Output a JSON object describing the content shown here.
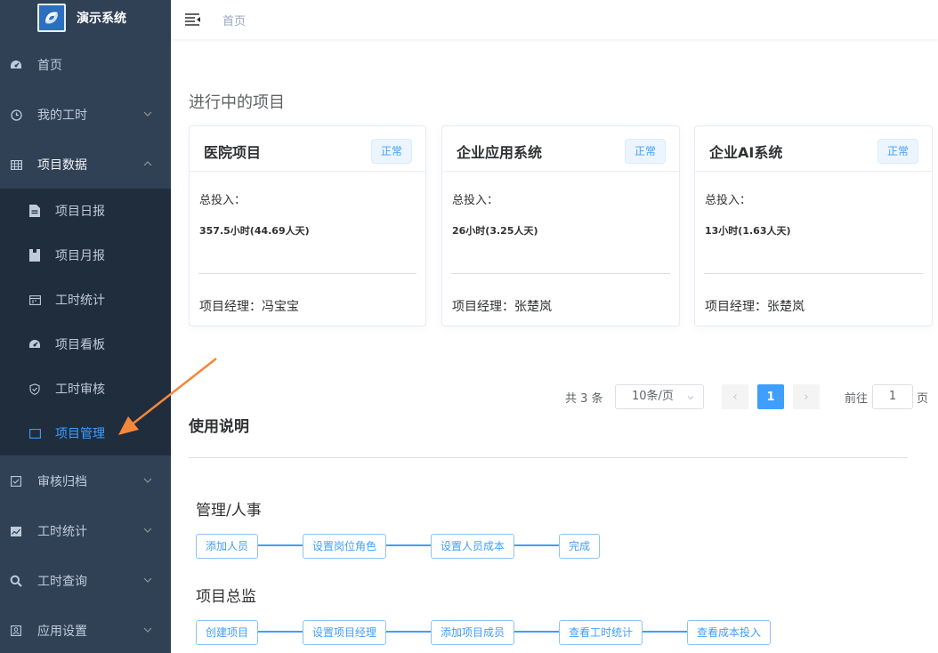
{
  "app": {
    "title": "演示系统",
    "colors": {
      "sidebar": "#304156",
      "submenu": "#1f2d3d",
      "accent": "#409eff",
      "annotation": "#f5873b"
    }
  },
  "sidebar": {
    "items": [
      {
        "label": "首页",
        "icon": "dashboard-icon"
      },
      {
        "label": "我的工时",
        "icon": "clock-icon",
        "arrow": "chevron-down"
      },
      {
        "label": "项目数据",
        "icon": "table-icon",
        "arrow": "chevron-up",
        "expanded": true
      },
      {
        "label": "审核归档",
        "icon": "checkbox-icon",
        "arrow": "chevron-down"
      },
      {
        "label": "工时统计",
        "icon": "image-chart-icon",
        "arrow": "chevron-down"
      },
      {
        "label": "工时查询",
        "icon": "search-icon",
        "arrow": "chevron-down"
      },
      {
        "label": "应用设置",
        "icon": "settings-icon",
        "arrow": "chevron-down"
      }
    ],
    "subitems": [
      {
        "label": "项目日报",
        "icon": "document-icon"
      },
      {
        "label": "项目月报",
        "icon": "clipboard-icon"
      },
      {
        "label": "工时统计",
        "icon": "calendar-icon"
      },
      {
        "label": "项目看板",
        "icon": "dashboard-icon"
      },
      {
        "label": "工时审核",
        "icon": "shield-icon"
      },
      {
        "label": "项目管理",
        "icon": "monitor-icon",
        "active": true
      }
    ]
  },
  "header": {
    "breadcrumb": "首页"
  },
  "projects": {
    "section_title": "进行中的项目",
    "items": [
      {
        "name": "医院项目",
        "status": "正常",
        "total_label": "总投入：",
        "total_value": "357.5小时(44.69人天)",
        "manager": "项目经理：冯宝宝"
      },
      {
        "name": "企业应用系统",
        "status": "正常",
        "total_label": "总投入：",
        "total_value": "26小时(3.25人天)",
        "manager": "项目经理：张楚岚"
      },
      {
        "name": "企业AI系统",
        "status": "正常",
        "total_label": "总投入：",
        "total_value": "13小时(1.63人天)",
        "manager": "项目经理：张楚岚"
      }
    ]
  },
  "pagination": {
    "total": "共 3 条",
    "page_size": "10条/页",
    "prev": "‹",
    "current_page": "1",
    "next": "›",
    "jump_prefix": "前往",
    "jump_value": "1",
    "jump_suffix": "页"
  },
  "usage": {
    "title": "使用说明",
    "flows": [
      {
        "title": "管理/人事",
        "steps": [
          "添加人员",
          "设置岗位角色",
          "设置人员成本",
          "完成"
        ]
      },
      {
        "title": "项目总监",
        "steps": [
          "创建项目",
          "设置项目经理",
          "添加项目成员",
          "查看工时统计",
          "查看成本投入"
        ]
      }
    ]
  }
}
